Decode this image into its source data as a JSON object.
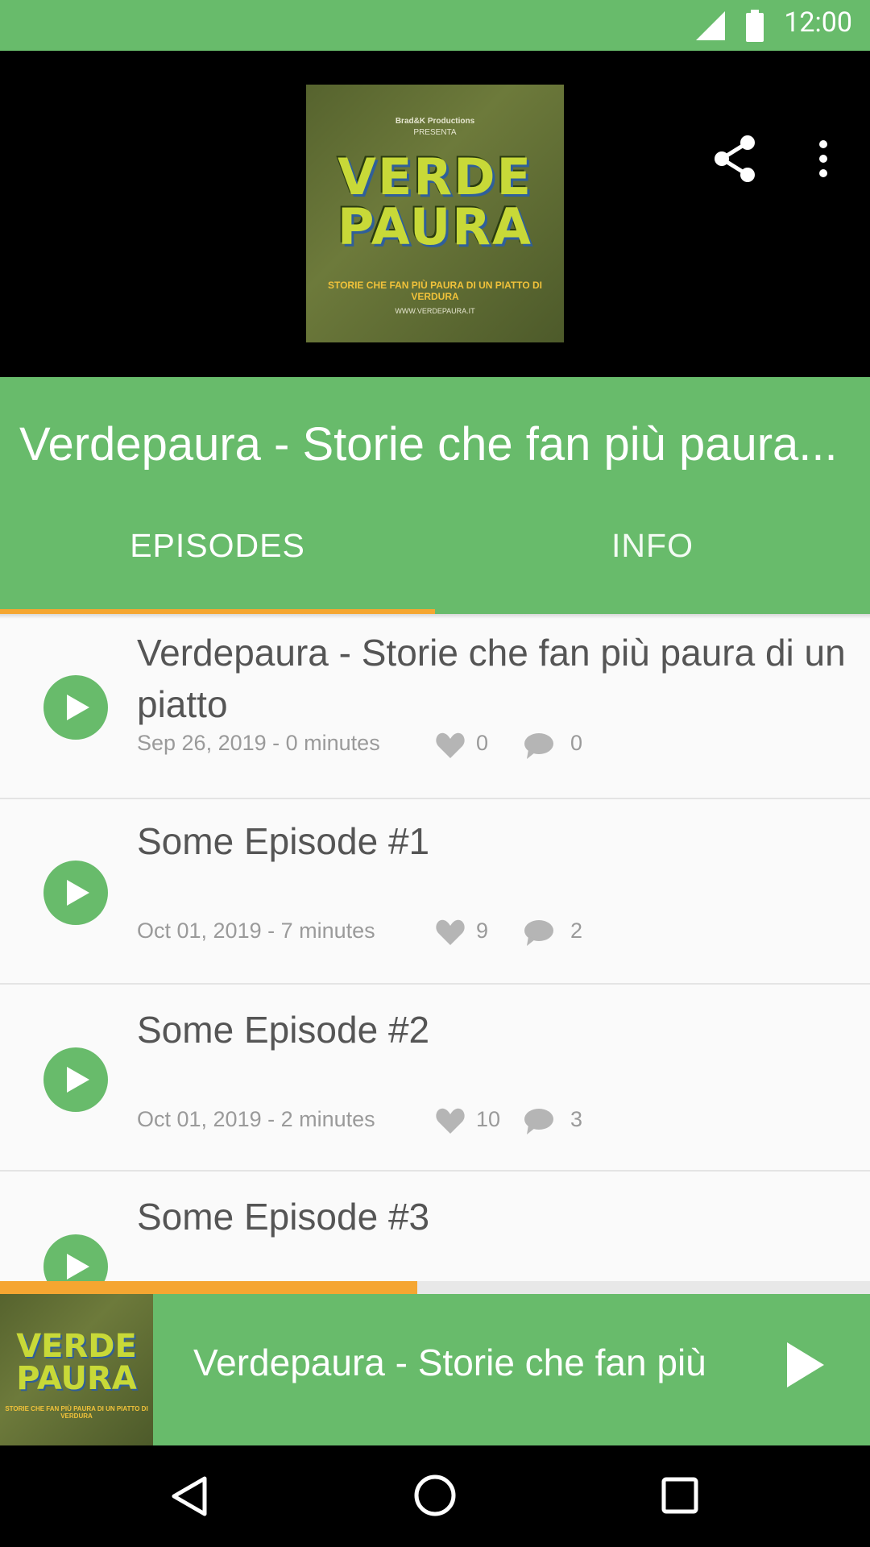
{
  "status_bar": {
    "time": "12:00",
    "signal_icon": "signal-icon",
    "battery_icon": "battery-icon"
  },
  "header": {
    "cover": {
      "brand": "Brad&K Productions",
      "presenta": "PRESENTA",
      "logo_line1": "VERDE",
      "logo_line2": "PAURA",
      "tagline": "STORIE CHE FAN PIÙ PAURA DI UN PIATTO DI VERDURA",
      "site": "WWW.VERDEPAURA.IT"
    },
    "share_icon": "share-icon",
    "more_icon": "more-vert-icon"
  },
  "podcast": {
    "title": "Verdepaura - Storie che fan più paura..."
  },
  "tabs": [
    {
      "label": "EPISODES",
      "selected": true
    },
    {
      "label": "INFO",
      "selected": false
    }
  ],
  "colors": {
    "primary": "#68bb6b",
    "accent": "#f5a631",
    "text": "#555555",
    "meta": "#9a9a9a"
  },
  "episodes": [
    {
      "title": "Verdepaura - Storie che fan più paura di un piatto",
      "meta": "Sep 26, 2019 - 0 minutes",
      "likes": "0",
      "comments": "0"
    },
    {
      "title": "Some Episode #1",
      "meta": "Oct 01, 2019 - 7 minutes",
      "likes": "9",
      "comments": "2"
    },
    {
      "title": "Some Episode #2",
      "meta": "Oct 01, 2019 - 2 minutes",
      "likes": "10",
      "comments": "3"
    },
    {
      "title": "Some Episode #3",
      "meta": "",
      "likes": "",
      "comments": ""
    }
  ],
  "player": {
    "progress": 0.48,
    "title": "Verdepaura - Storie che fan più",
    "art": {
      "logo_line1": "VERDE",
      "logo_line2": "PAURA",
      "tagline": "STORIE CHE FAN PIÙ PAURA DI UN PIATTO DI VERDURA"
    },
    "play_icon": "play-icon"
  },
  "nav": {
    "back_icon": "back-icon",
    "home_icon": "home-icon",
    "recents_icon": "recents-icon"
  }
}
